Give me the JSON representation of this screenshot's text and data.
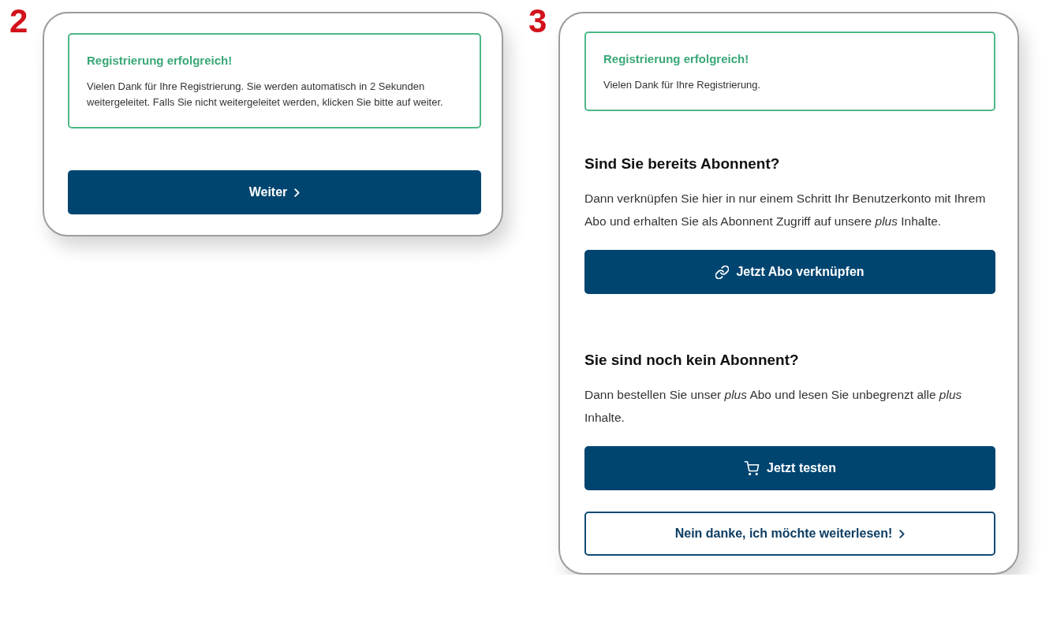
{
  "panels": [
    {
      "step_number": "2",
      "alert": {
        "title": "Registrierung erfolgreich!",
        "text": "Vielen Dank für Ihre Registrierung. Sie werden automatisch in 2 Sekunden weitergeleitet. Falls Sie nicht weitergeleitet werden, klicken Sie bitte auf weiter."
      },
      "buttons": [
        {
          "kind": "primary",
          "label": "Weiter"
        }
      ]
    },
    {
      "step_number": "3",
      "alert": {
        "title": "Registrierung erfolgreich!",
        "text": "Vielen Dank für Ihre Registrierung."
      },
      "sections": [
        {
          "kind": "existing",
          "heading": "Sind Sie bereits Abonnent?",
          "text": "Dann verknüpfen Sie hier in nur einem Schritt Ihr Benutzerkonto mit Ihrem Abo und erhalten Sie als Abonnent Zugriff auf unsere *plus* Inhalte.",
          "button": {
            "label": "Jetzt Abo verknüpfen"
          }
        },
        {
          "kind": "new",
          "heading": "Sie sind noch kein Abonnent?",
          "text": "Dann bestellen Sie unser *plus* Abo und lesen Sie unbegrenzt alle *plus* Inhalte.",
          "button": {
            "label": "Jetzt testen"
          }
        }
      ],
      "buttons": [
        {
          "kind": "outline",
          "label": "Nein danke, ich möchte weiterlesen!"
        }
      ]
    }
  ]
}
